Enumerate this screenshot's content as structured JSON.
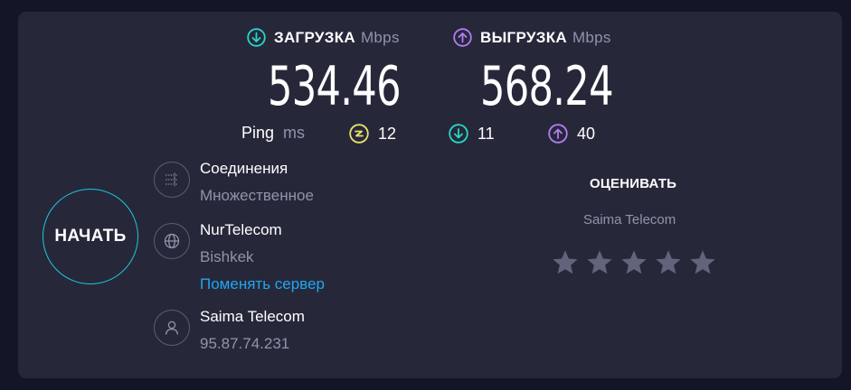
{
  "download": {
    "label": "ЗАГРУЗКА",
    "unit": "Mbps",
    "value": "534.46",
    "color": "#27d6c7"
  },
  "upload": {
    "label": "ВЫГРУЗКА",
    "unit": "Mbps",
    "value": "568.24",
    "color": "#b47cf2"
  },
  "ping": {
    "label": "Ping",
    "unit": "ms",
    "idle": {
      "value": "12",
      "icon": "lightning-ping-icon",
      "color": "#e8e36a"
    },
    "download": {
      "value": "11",
      "icon": "download-ping-icon",
      "color": "#27d6c7"
    },
    "upload": {
      "value": "40",
      "icon": "upload-ping-icon",
      "color": "#b47cf2"
    }
  },
  "start_button": {
    "label": "НАЧАТЬ",
    "color": "#1dc8d8"
  },
  "connections": {
    "title": "Соединения",
    "value": "Множественное",
    "icon": "connections-icon"
  },
  "server": {
    "title": "NurTelecom",
    "location": "Bishkek",
    "change_link": "Поменять сервер",
    "icon": "globe-icon"
  },
  "provider": {
    "title": "Saima Telecom",
    "ip": "95.87.74.231",
    "icon": "user-icon"
  },
  "rating": {
    "title": "ОЦЕНИВАТЬ",
    "provider": "Saima Telecom",
    "stars": 5,
    "star_color": "#61647a"
  }
}
